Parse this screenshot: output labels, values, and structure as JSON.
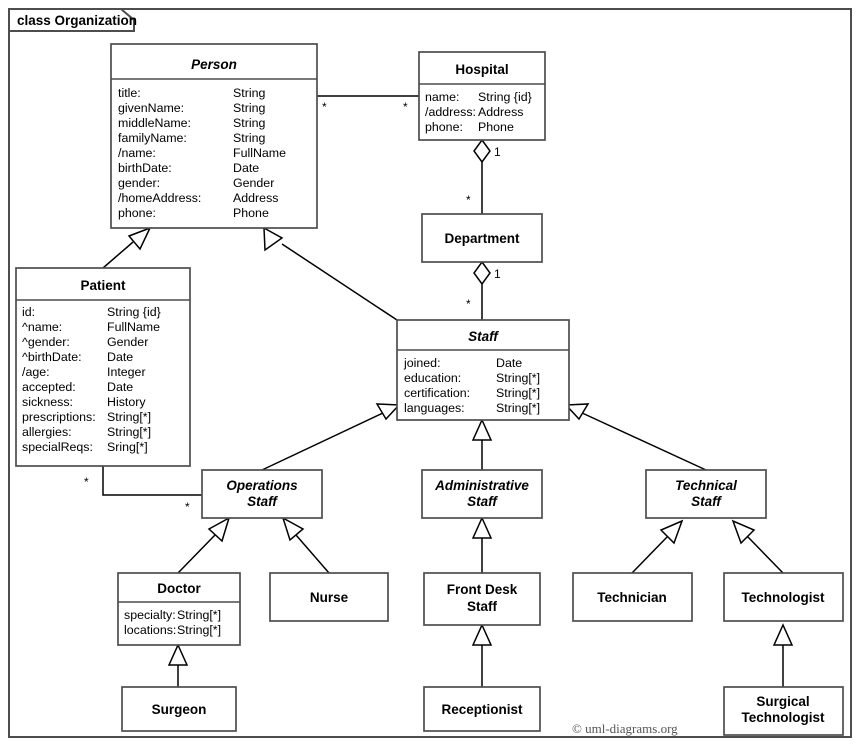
{
  "frame": {
    "label": "class Organization",
    "copyright": "© uml-diagrams.org"
  },
  "classes": {
    "person": {
      "name": "Person",
      "abstract": true,
      "attributes": [
        {
          "name": "title:",
          "type": "String"
        },
        {
          "name": "givenName:",
          "type": "String"
        },
        {
          "name": "middleName:",
          "type": "String"
        },
        {
          "name": "familyName:",
          "type": "String"
        },
        {
          "name": "/name:",
          "type": "FullName"
        },
        {
          "name": "birthDate:",
          "type": "Date"
        },
        {
          "name": "gender:",
          "type": "Gender"
        },
        {
          "name": "/homeAddress:",
          "type": "Address"
        },
        {
          "name": "phone:",
          "type": "Phone"
        }
      ]
    },
    "hospital": {
      "name": "Hospital",
      "abstract": false,
      "attributes": [
        {
          "name": "name:",
          "type": "String {id}"
        },
        {
          "name": "/address:",
          "type": "Address"
        },
        {
          "name": "phone:",
          "type": "Phone"
        }
      ]
    },
    "department": {
      "name": "Department",
      "abstract": false,
      "attributes": []
    },
    "patient": {
      "name": "Patient",
      "abstract": false,
      "attributes": [
        {
          "name": "id:",
          "type": "String {id}"
        },
        {
          "name": "^name:",
          "type": "FullName"
        },
        {
          "name": "^gender:",
          "type": "Gender"
        },
        {
          "name": "^birthDate:",
          "type": "Date"
        },
        {
          "name": "/age:",
          "type": "Integer"
        },
        {
          "name": "accepted:",
          "type": "Date"
        },
        {
          "name": "sickness:",
          "type": "History"
        },
        {
          "name": "prescriptions:",
          "type": "String[*]"
        },
        {
          "name": "allergies:",
          "type": "String[*]"
        },
        {
          "name": "specialReqs:",
          "type": "Sring[*]"
        }
      ]
    },
    "staff": {
      "name": "Staff",
      "abstract": true,
      "attributes": [
        {
          "name": "joined:",
          "type": "Date"
        },
        {
          "name": "education:",
          "type": "String[*]"
        },
        {
          "name": "certification:",
          "type": "String[*]"
        },
        {
          "name": "languages:",
          "type": "String[*]"
        }
      ]
    },
    "operations_staff": {
      "name_line1": "Operations",
      "name_line2": "Staff",
      "abstract": true
    },
    "administrative_staff": {
      "name_line1": "Administrative",
      "name_line2": "Staff",
      "abstract": true
    },
    "technical_staff": {
      "name_line1": "Technical",
      "name_line2": "Staff",
      "abstract": true
    },
    "doctor": {
      "name": "Doctor",
      "abstract": false,
      "attributes": [
        {
          "name": "specialty:",
          "type": "String[*]"
        },
        {
          "name": "locations:",
          "type": "String[*]"
        }
      ]
    },
    "nurse": {
      "name": "Nurse",
      "abstract": false,
      "attributes": []
    },
    "front_desk_staff": {
      "name_line1": "Front Desk",
      "name_line2": "Staff",
      "abstract": false
    },
    "technician": {
      "name": "Technician",
      "abstract": false,
      "attributes": []
    },
    "technologist": {
      "name": "Technologist",
      "abstract": false,
      "attributes": []
    },
    "surgeon": {
      "name": "Surgeon",
      "abstract": false,
      "attributes": []
    },
    "receptionist": {
      "name": "Receptionist",
      "abstract": false,
      "attributes": []
    },
    "surgical_technologist": {
      "name_line1": "Surgical",
      "name_line2": "Technologist",
      "abstract": false
    }
  },
  "multiplicities": {
    "person_to_hospital_source": "*",
    "person_to_hospital_target": "*",
    "hospital_to_department_whole": "1",
    "hospital_to_department_part": "*",
    "department_to_staff_whole": "1",
    "department_to_staff_part": "*",
    "patient_to_operations_source": "*",
    "patient_to_operations_target": "*"
  }
}
